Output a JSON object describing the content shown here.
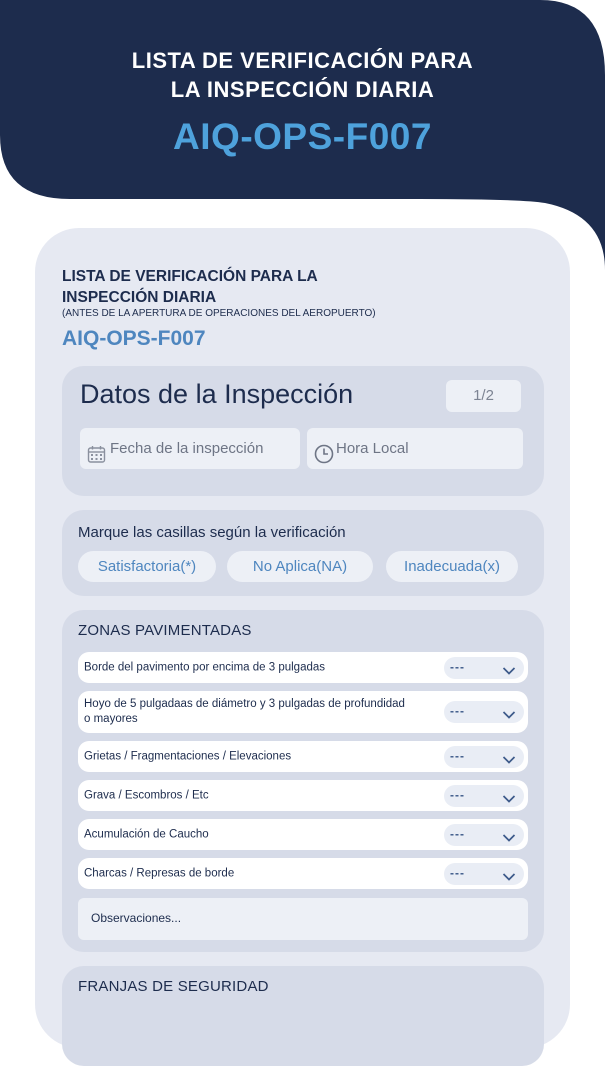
{
  "header": {
    "title_line1": "LISTA DE VERIFICACIÓN PARA",
    "title_line2": "LA INSPECCIÓN DIARIA",
    "code": "AIQ-OPS-F007"
  },
  "card": {
    "title_line1": "LISTA DE VERIFICACIÓN PARA LA",
    "title_line2": "INSPECCIÓN DIARIA",
    "subtitle": "(ANTES DE LA APERTURA DE OPERACIONES DEL AEROPUERTO)",
    "code": "AIQ-OPS-F007"
  },
  "inspection": {
    "title": "Datos de la Inspección",
    "page": "1/2",
    "date_placeholder": "Fecha de la  inspección",
    "time_placeholder": "Hora Local"
  },
  "legend": {
    "instruction": "Marque las casillas según la verificación",
    "options": [
      "Satisfactoria(*)",
      "No Aplica(NA)",
      "Inadecuada(x)"
    ]
  },
  "paved_zones": {
    "title": "ZONAS PAVIMENTADAS",
    "items": [
      {
        "label": "Borde del pavimento por encima de 3 pulgadas",
        "value": "---"
      },
      {
        "label": "Hoyo de 5 pulgadaas de diámetro y 3 pulgadas de profundidad o mayores",
        "value": "---"
      },
      {
        "label": "Grietas / Fragmentaciones / Elevaciones",
        "value": "---"
      },
      {
        "label": "Grava / Escombros / Etc",
        "value": "---"
      },
      {
        "label": "Acumulación de Caucho",
        "value": "---"
      },
      {
        "label": "Charcas / Represas de borde",
        "value": "---"
      }
    ],
    "observations_placeholder": "Observaciones..."
  },
  "safety_strips": {
    "title": "FRANJAS DE SEGURIDAD"
  },
  "colors": {
    "navy": "#1d2c4d",
    "accent_blue": "#4ea2dc",
    "card_bg": "#e6e9f2",
    "section_bg": "#d6dbe8"
  },
  "icons": [
    "calendar-icon",
    "clock-icon",
    "chevron-down-icon"
  ]
}
